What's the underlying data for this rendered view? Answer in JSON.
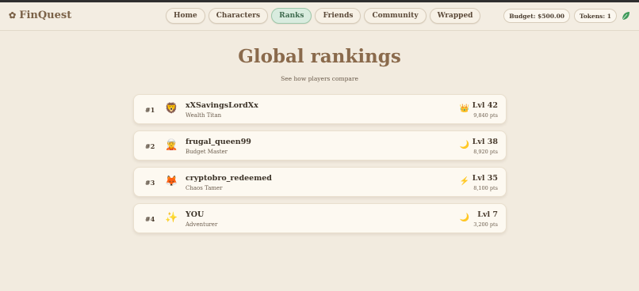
{
  "brand": {
    "name": "FinQuest",
    "icon": "flower-icon"
  },
  "nav": {
    "items": [
      {
        "label": "Home"
      },
      {
        "label": "Characters"
      },
      {
        "label": "Ranks",
        "active": true
      },
      {
        "label": "Friends"
      },
      {
        "label": "Community"
      },
      {
        "label": "Wrapped"
      }
    ]
  },
  "stats": {
    "budget": "Budget: $500.00",
    "tokens": "Tokens: 1"
  },
  "page": {
    "title": "Global rankings",
    "subtitle": "See how players compare"
  },
  "rankings": [
    {
      "rank": "#1",
      "avatar_glyph": "🦁",
      "avatar_icon": "lion-icon",
      "name": "xXSavingsLordXx",
      "role": "Wealth Titan",
      "badge_glyph": "👑",
      "badge_icon": "crown-icon",
      "level": "Lvl 42",
      "points": "9,840 pts"
    },
    {
      "rank": "#2",
      "avatar_glyph": "🧝",
      "avatar_icon": "elf-icon",
      "name": "frugal_queen99",
      "role": "Budget Master",
      "badge_glyph": "🌙",
      "badge_icon": "moon-icon",
      "level": "Lvl 38",
      "points": "8,920 pts"
    },
    {
      "rank": "#3",
      "avatar_glyph": "🦊",
      "avatar_icon": "fox-icon",
      "name": "cryptobro_redeemed",
      "role": "Chaos Tamer",
      "badge_glyph": "⚡",
      "badge_icon": "lightning-icon",
      "level": "Lvl 35",
      "points": "8,100 pts"
    },
    {
      "rank": "#4",
      "avatar_glyph": "✨",
      "avatar_icon": "sparkles-icon",
      "name": "YOU",
      "role": "Adventurer",
      "badge_glyph": "🌙",
      "badge_icon": "moon-icon",
      "level": "Lvl 7",
      "points": "3,200 pts"
    }
  ],
  "colors": {
    "background": "#f2ebdf",
    "accent": "#8a6a4c",
    "active_tab": "#d9ecdf",
    "leaf": "#3f9a5a"
  }
}
